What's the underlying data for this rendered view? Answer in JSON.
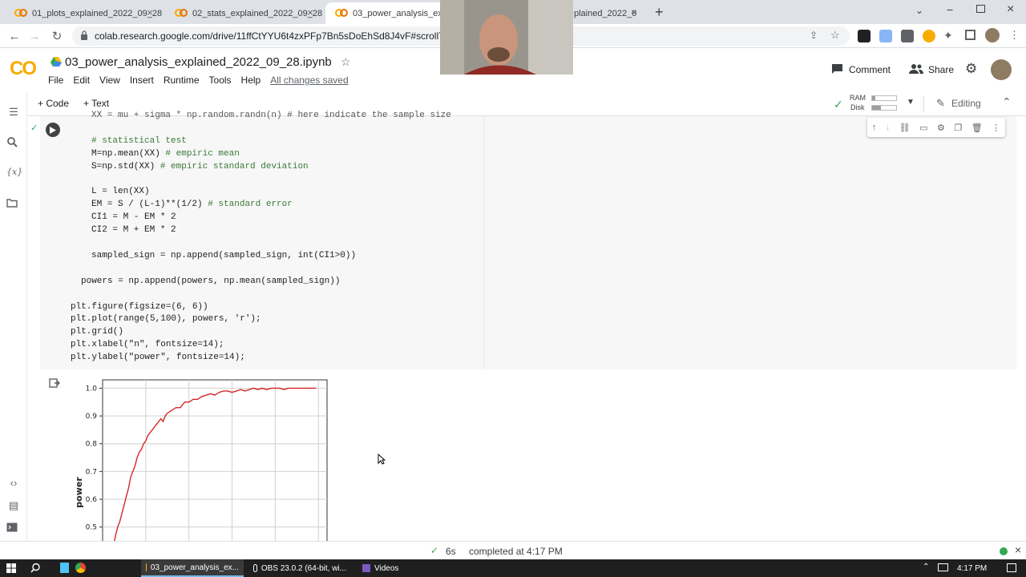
{
  "browser": {
    "tabs": [
      {
        "title": "01_plots_explained_2022_09_28.i",
        "active": false
      },
      {
        "title": "02_stats_explained_2022_09_28.i",
        "active": false
      },
      {
        "title": "03_power_analysis_explai",
        "active": true
      },
      {
        "title": "plained_2022_0",
        "active": false
      }
    ],
    "new_tab_symbol": "+",
    "url": "colab.research.google.com/drive/11ffCtYYU6t4zxPFp7Bn5sDoEhSd8J4vF#scrollTo=k"
  },
  "colab": {
    "logo": "CO",
    "notebook_title": "03_power_analysis_explained_2022_09_28.ipynb",
    "menu": [
      "File",
      "Edit",
      "View",
      "Insert",
      "Runtime",
      "Tools",
      "Help"
    ],
    "saved_status": "All changes saved",
    "comment_label": "Comment",
    "share_label": "Share",
    "add_code_label": "+ Code",
    "add_text_label": "+ Text",
    "ram_label": "RAM",
    "disk_label": "Disk",
    "editing_label": "Editing"
  },
  "code": {
    "lines": [
      {
        "indent": 1,
        "text": "XX = mu + sigma * np.random.randn(n) # here indicate the sample size",
        "cut": true
      },
      {
        "indent": 0,
        "text": ""
      },
      {
        "indent": 1,
        "text": "# statistical test",
        "cls": "cm"
      },
      {
        "indent": 1,
        "text": "M=np.mean(XX) ",
        "comment": "# empiric mean"
      },
      {
        "indent": 1,
        "text": "S=np.std(XX) ",
        "comment": "# empiric standard deviation"
      },
      {
        "indent": 0,
        "text": ""
      },
      {
        "indent": 1,
        "text": "L = len(XX)"
      },
      {
        "indent": 1,
        "text": "EM = S / (L-1)**(1/2) ",
        "comment": "# standard error"
      },
      {
        "indent": 1,
        "text": "CI1 = M - EM * 2"
      },
      {
        "indent": 1,
        "text": "CI2 = M + EM * 2"
      },
      {
        "indent": 0,
        "text": ""
      },
      {
        "indent": 1,
        "text": "sampled_sign = np.append(sampled_sign, int(CI1>0))"
      },
      {
        "indent": 0,
        "text": ""
      },
      {
        "indent": 0.5,
        "text": "powers = np.append(powers, np.mean(sampled_sign))"
      },
      {
        "indent": 0,
        "text": ""
      },
      {
        "indent": 0,
        "text": "plt.figure(figsize=(6, 6))"
      },
      {
        "indent": 0,
        "text": "plt.plot(range(5,100), powers, 'r');"
      },
      {
        "indent": 0,
        "text": "plt.grid()"
      },
      {
        "indent": 0,
        "text": "plt.xlabel(\"n\", fontsize=14);"
      },
      {
        "indent": 0,
        "text": "plt.ylabel(\"power\", fontsize=14);"
      }
    ]
  },
  "status": {
    "exec_time": "6s",
    "completed": "completed at 4:17 PM"
  },
  "taskbar": {
    "items": [
      "03_power_analysis_ex...",
      "OBS 23.0.2 (64-bit, wi...",
      "Videos"
    ],
    "clock": "4:17 PM"
  },
  "chart_data": {
    "type": "line",
    "title": "",
    "xlabel": "",
    "ylabel": "power",
    "ylim": [
      0.45,
      1.03
    ],
    "yticks": [
      0.5,
      0.6,
      0.7,
      0.8,
      0.9,
      1.0
    ],
    "ytick_labels": [
      "0.5",
      "0.6",
      "0.7",
      "0.8",
      "0.9",
      "1.0"
    ],
    "grid": true,
    "series": [
      {
        "color": "#d62728",
        "x": [
          5,
          6,
          7,
          8,
          9,
          10,
          11,
          12,
          13,
          14,
          15,
          16,
          17,
          18,
          19,
          20,
          21,
          22,
          23,
          24,
          25,
          26,
          27,
          28,
          29,
          30,
          32,
          34,
          36,
          38,
          40,
          42,
          44,
          46,
          48,
          50,
          52,
          54,
          56,
          58,
          60,
          62,
          64,
          66,
          68,
          70,
          72,
          74,
          76,
          78,
          80,
          82,
          84,
          86,
          88,
          90,
          92,
          94,
          96,
          98,
          99
        ],
        "y": [
          0.43,
          0.47,
          0.5,
          0.52,
          0.55,
          0.58,
          0.61,
          0.64,
          0.68,
          0.7,
          0.72,
          0.75,
          0.77,
          0.78,
          0.8,
          0.81,
          0.83,
          0.84,
          0.85,
          0.86,
          0.87,
          0.88,
          0.89,
          0.88,
          0.9,
          0.91,
          0.92,
          0.93,
          0.93,
          0.95,
          0.95,
          0.96,
          0.96,
          0.97,
          0.975,
          0.98,
          0.975,
          0.985,
          0.99,
          0.99,
          0.985,
          0.99,
          0.995,
          0.99,
          0.995,
          1.0,
          0.995,
          1.0,
          0.995,
          1.0,
          1.0,
          1.0,
          0.995,
          1.0,
          1.0,
          1.0,
          1.0,
          1.0,
          1.0,
          1.0,
          1.0
        ]
      }
    ]
  }
}
